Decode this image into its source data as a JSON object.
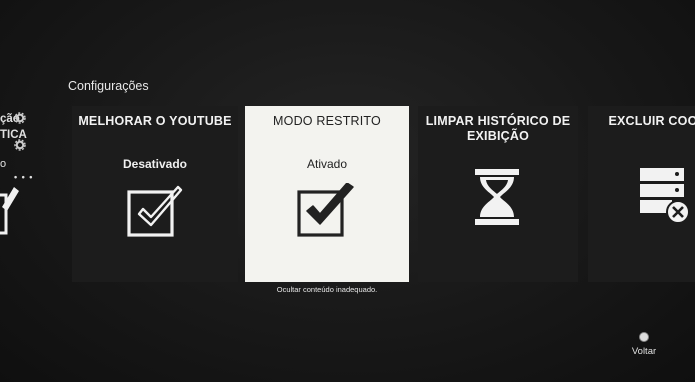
{
  "section": {
    "title": "Configurações"
  },
  "partial_left": {
    "line1": "ção",
    "line2": "TICA",
    "line3": "o",
    "dots": "• • •"
  },
  "cards": [
    {
      "title": "MELHORAR O YOUTUBE",
      "status": "Desativado",
      "icon": "checkbox-outline-icon"
    },
    {
      "title": "MODO RESTRITO",
      "status": "Ativado",
      "icon": "checkbox-checked-icon",
      "caption": "Ocultar conteúdo inadequado."
    },
    {
      "title": "LIMPAR HISTÓRICO DE EXIBIÇÃO",
      "icon": "hourglass-icon"
    },
    {
      "title": "EXCLUIR COO",
      "icon": "cookie-server-delete-icon"
    }
  ],
  "back": {
    "label": "Voltar"
  },
  "colors": {
    "selected_card": "#f3f3ef",
    "card": "#1c1c1c",
    "background": "#181818"
  }
}
